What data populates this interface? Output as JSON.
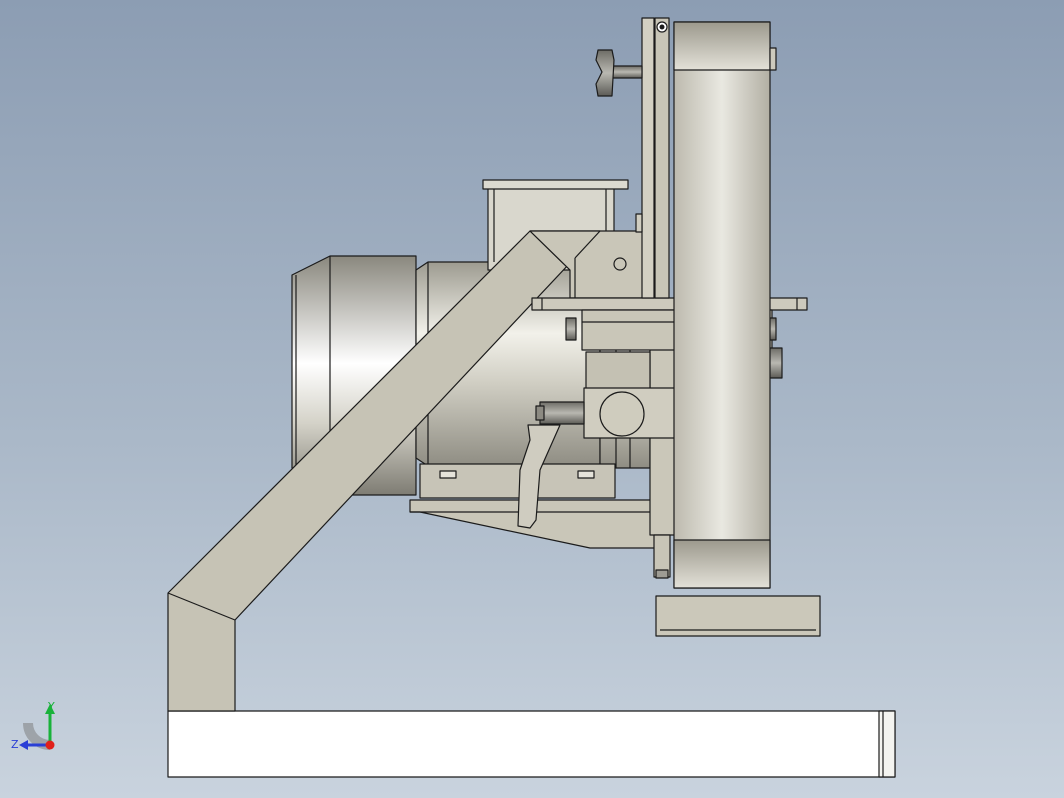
{
  "triad": {
    "y_label": "Y",
    "z_label": "Z",
    "y_color": "#19b23a",
    "z_color": "#2a3fd6",
    "x_color": "#e0201a"
  },
  "colors": {
    "background_top": "#8c9db3",
    "background_bottom": "#c9d3de",
    "part_fill": "#c9c6b8",
    "part_edge": "#1b1b1b"
  }
}
